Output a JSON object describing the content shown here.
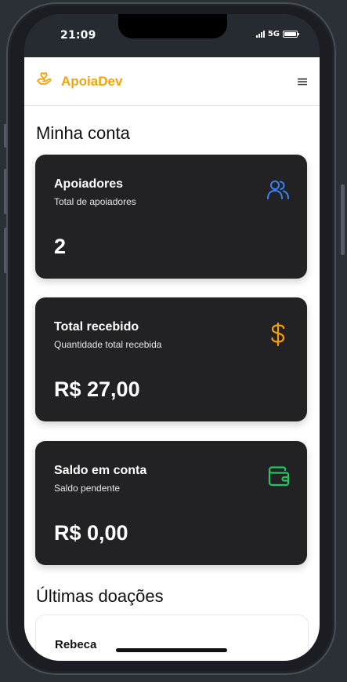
{
  "status": {
    "time": "21:09",
    "network": "5G"
  },
  "header": {
    "brand": "ApoiaDev",
    "logo_icon": "hand-heart-icon",
    "menu_icon": "hamburger-menu-icon",
    "menu_glyph": "≡"
  },
  "page": {
    "title": "Minha conta"
  },
  "cards": [
    {
      "title": "Apoiadores",
      "subtitle": "Total de apoiadores",
      "value": "2",
      "icon": "users-icon",
      "icon_color": "#3b82f6"
    },
    {
      "title": "Total recebido",
      "subtitle": "Quantidade total recebida",
      "value": "R$ 27,00",
      "icon": "dollar-icon",
      "icon_color": "#f59e0b"
    },
    {
      "title": "Saldo em conta",
      "subtitle": "Saldo pendente",
      "value": "R$ 0,00",
      "icon": "wallet-icon",
      "icon_color": "#22c55e"
    }
  ],
  "donations": {
    "title": "Últimas doações",
    "items": [
      {
        "name": "Rebeca"
      }
    ]
  },
  "colors": {
    "accent": "#f5a30c",
    "card_bg": "#222224"
  }
}
